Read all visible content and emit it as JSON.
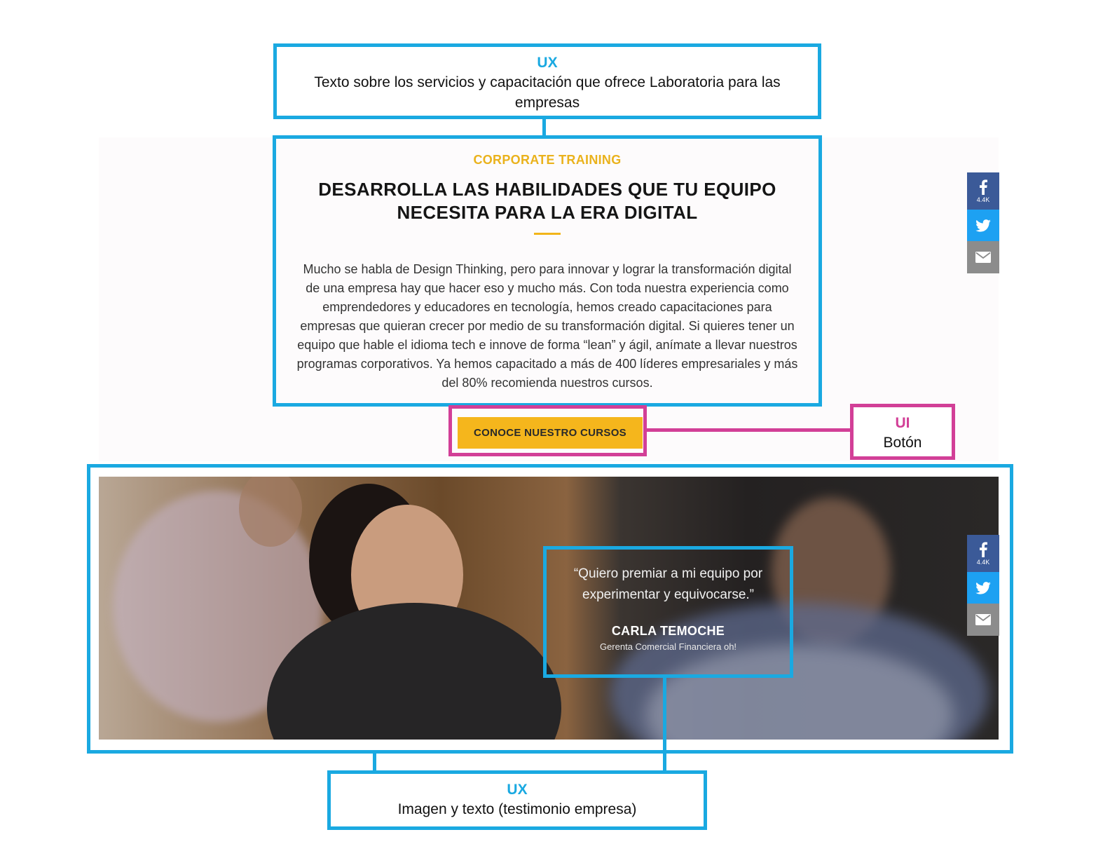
{
  "annotations": {
    "top": {
      "tag": "UX",
      "text": "Texto sobre los servicios y capacitación que ofrece Laboratoria para las empresas"
    },
    "button": {
      "tag": "UI",
      "text": "Botón"
    },
    "bottom": {
      "tag": "UX",
      "text": "Imagen y texto (testimonio empresa)"
    }
  },
  "corporate": {
    "eyebrow": "CORPORATE TRAINING",
    "headline_line1": "DESARROLLA LAS HABILIDADES QUE TU EQUIPO",
    "headline_line2": "NECESITA PARA LA ERA DIGITAL",
    "body": "Mucho se habla de Design Thinking, pero para innovar y lograr la transformación digital de una empresa hay que hacer eso y mucho más. Con toda nuestra experiencia como emprendedores y educadores en tecnología, hemos creado capacitaciones para empresas que quieran crecer por medio de su transformación digital. Si quieres tener un equipo que hable el idioma tech e innove de forma “lean” y ágil, anímate a llevar nuestros programas corporativos. Ya hemos capacitado a más de 400 líderes empresariales y más del 80% recomienda nuestros cursos.",
    "cta_label": "CONOCE NUESTRO CURSOS"
  },
  "testimonial": {
    "quote": "“Quiero premiar a mi equipo por experimentar y equivocarse.”",
    "name": "CARLA TEMOCHE",
    "role": "Gerenta Comercial Financiera oh!"
  },
  "share": {
    "facebook_count": "4.4K",
    "icons": [
      "facebook-icon",
      "twitter-icon",
      "mail-icon"
    ]
  },
  "colors": {
    "annotation_blue": "#1aa9e1",
    "annotation_pink": "#d23f97",
    "accent_yellow": "#f5b61c",
    "facebook": "#3b5a98",
    "twitter": "#1da1f2",
    "mail": "#8c8c8c"
  }
}
